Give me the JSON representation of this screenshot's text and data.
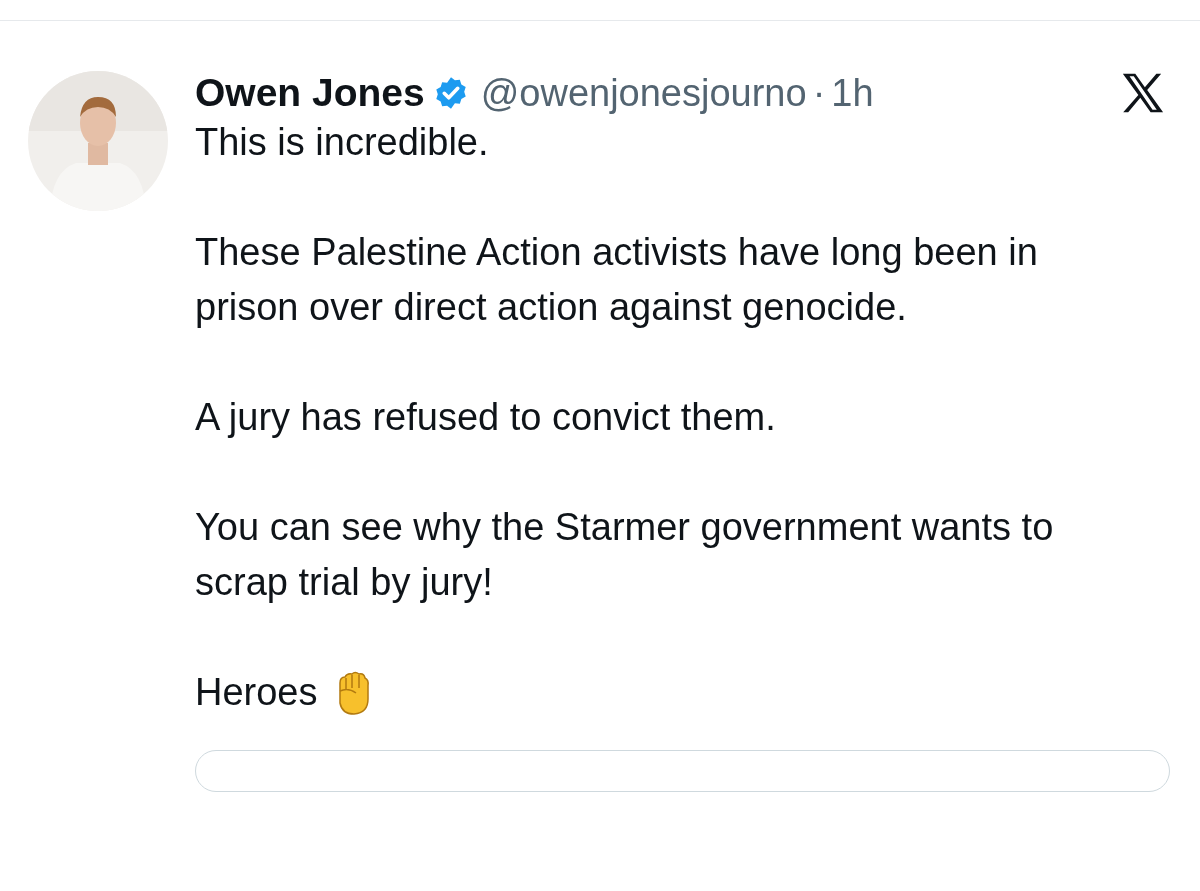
{
  "post": {
    "author": {
      "name": "Owen Jones",
      "verified": true,
      "handle": "@owenjonesjourno",
      "separator": "·",
      "time": "1h"
    },
    "paragraphs": [
      "This is incredible.",
      "These Palestine Action activists have long been in prison over direct action against genocide.",
      "A jury has refused to convict them.",
      "You can see why the Starmer government wants to scrap trial by jury!",
      "Heroes"
    ]
  }
}
